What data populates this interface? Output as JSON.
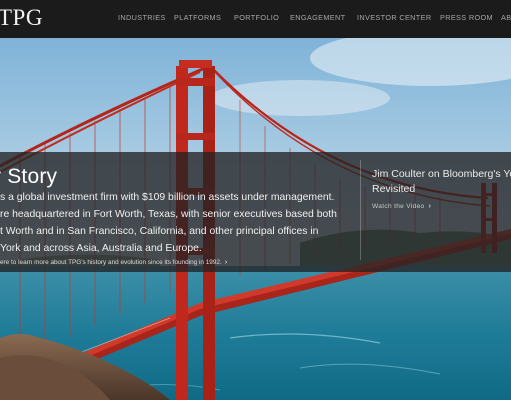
{
  "header": {
    "logo": "TPG",
    "nav": [
      {
        "label": "INDUSTRIES"
      },
      {
        "label": "PLATFORMS"
      },
      {
        "label": "PORTFOLIO"
      },
      {
        "label": "ENGAGEMENT"
      },
      {
        "label": "INVESTOR CENTER"
      },
      {
        "label": "PRESS ROOM"
      },
      {
        "label": "AB"
      }
    ]
  },
  "story": {
    "title": "r Story",
    "lines": [
      "s a global investment firm with $109 billion in assets under management.",
      "re headquartered in Fort Worth, Texas, with senior executives based both",
      "t Worth and in San Francisco, California, and other principal offices in",
      "York and across Asia, Australia and Europe."
    ],
    "link": "ere to learn more about TPG's history and evolution since its founding in 1992."
  },
  "video": {
    "title_line1": "Jim Coulter on Bloomberg's Year",
    "title_line2": "Revisited",
    "link": "Watch the Video"
  },
  "colors": {
    "nav_bg": "#1b1b1b",
    "nav_text": "#a6a6a6",
    "bridge": "#c8281e",
    "band": "#222224",
    "water": "#2e8fa6",
    "sky": "#cfe3ee"
  }
}
